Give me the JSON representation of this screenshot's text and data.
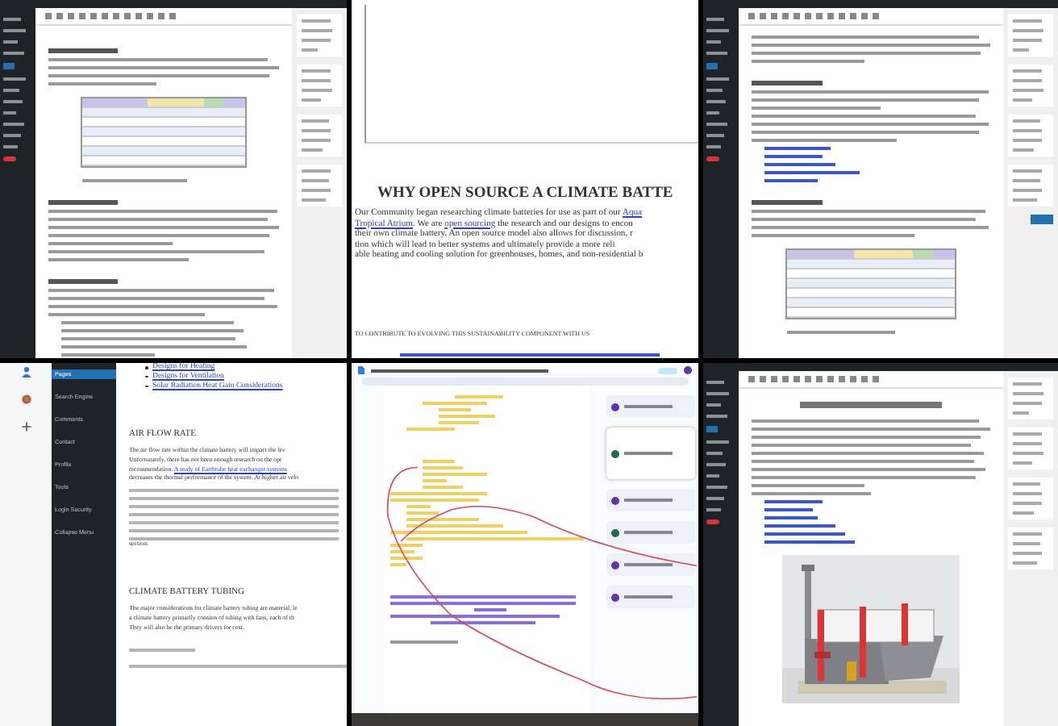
{
  "panels": [
    {
      "kind": "wp-editor-table"
    },
    {
      "kind": "article",
      "heading": "WHY OPEN SOURCE A CLIMATE BATTE",
      "paragraph": [
        [
          {
            "text": "Our Community began researching climate batteries for use as part of our ",
            "link": false
          },
          {
            "text": "Aqua",
            "link": true
          }
        ],
        [
          {
            "text": "Tropical Atrium",
            "link": true
          },
          {
            "text": ". We are ",
            "link": false
          },
          {
            "text": "open sourcing",
            "link": true
          },
          {
            "text": " the research and our designs to encou",
            "link": false
          }
        ],
        [
          {
            "text": "their own climate battery. An open source model also allows for discussion, r",
            "link": false
          }
        ],
        [
          {
            "text": "tion which will lead to better systems and ultimately provide a more reli",
            "link": false
          }
        ],
        [
          {
            "text": "able heating and cooling solution for greenhouses, homes, and non-residential b",
            "link": false
          }
        ]
      ],
      "subheading": "TO CONTRIBUTE TO EVOLVING THIS SUSTAINABILITY COMPONENT WITH US"
    },
    {
      "kind": "wp-editor-links"
    },
    {
      "kind": "wp-article",
      "menu": [
        {
          "label": "Pages",
          "selected": true
        },
        {
          "label": "Search Engine",
          "selected": false
        },
        {
          "label": "Comments",
          "selected": false
        },
        {
          "label": "Contact",
          "selected": false
        },
        {
          "label": "Profile",
          "selected": false
        },
        {
          "label": "Tools",
          "selected": false
        },
        {
          "label": "Login Security",
          "selected": false
        },
        {
          "label": "Collapse Menu",
          "selected": false
        }
      ],
      "links": [
        "Designs for Heating",
        "Designs for Ventilation",
        "Solar Radiation Heat Gain Considerations"
      ],
      "sections": [
        {
          "heading": "AIR FLOW RATE",
          "lines": [
            [
              {
                "text": "The air flow rate within the climate battery will impact the lev",
                "link": false
              }
            ],
            [
              {
                "text": "Unfortunately, there has not been enough research on the opt",
                "link": false
              }
            ],
            [
              {
                "text": "recommendation. ",
                "link": false
              },
              {
                "text": "A study of Earthtube heat exchanger systems",
                "link": true
              }
            ],
            [
              {
                "text": "decreases the thermal performance of the system. At higher air velo",
                "link": false
              }
            ]
          ],
          "tail": "section."
        },
        {
          "heading": "CLIMATE BATTERY TUBING",
          "lines": [
            [
              {
                "text": "The major considerations for climate battery tubing are material, le",
                "link": false
              }
            ],
            [
              {
                "text": "a climate battery primarily consists of tubing with fans, each of th",
                "link": false
              }
            ],
            [
              {
                "text": "They will also be the primary drivers for cost.",
                "link": false
              }
            ]
          ]
        }
      ]
    },
    {
      "kind": "google-doc"
    },
    {
      "kind": "wp-editor-image"
    }
  ]
}
